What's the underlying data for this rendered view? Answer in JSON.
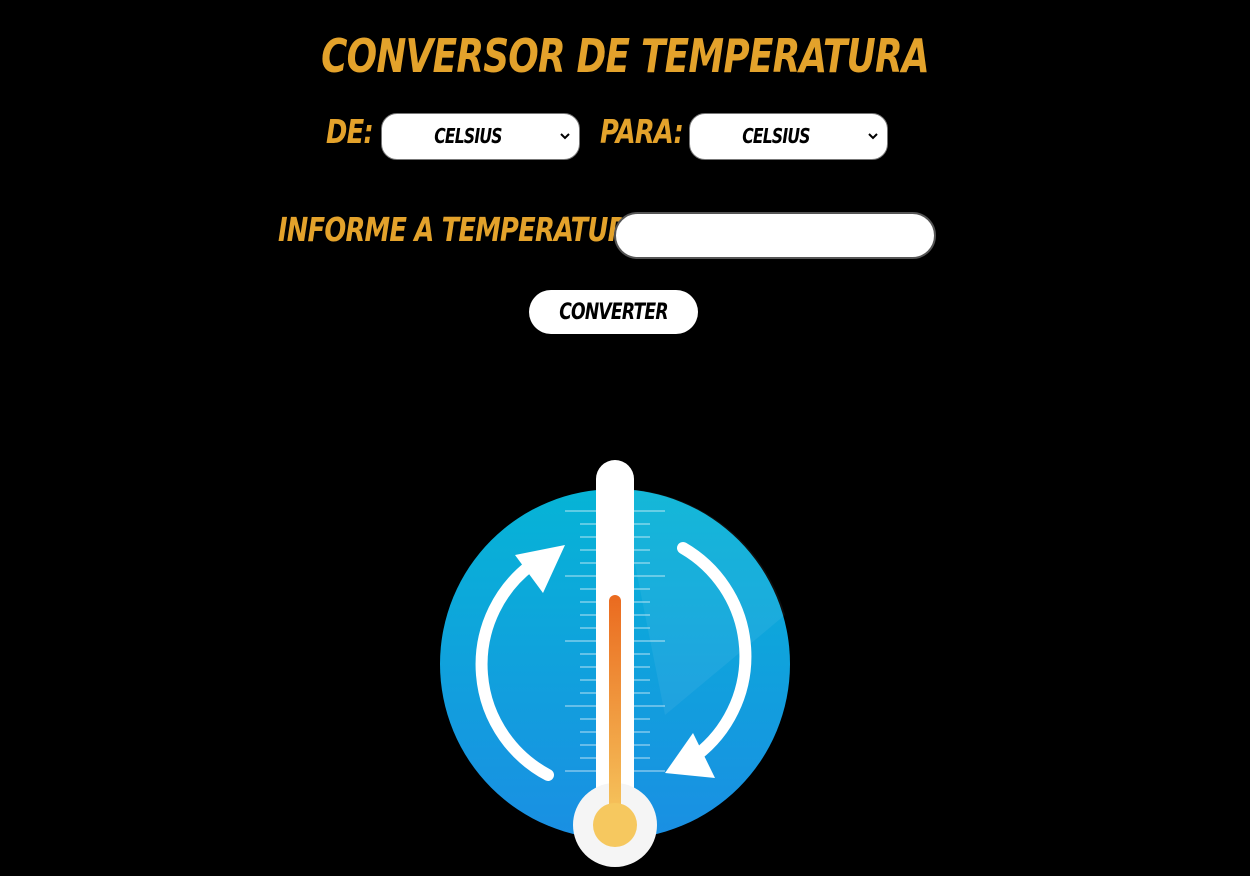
{
  "header": {
    "title": "CONVERSOR DE TEMPERATURA"
  },
  "form": {
    "from_label": "DE:",
    "from_value": "CELSIUS",
    "to_label": "PARA:",
    "to_value": "CELSIUS",
    "temperature_label": "INFORME A TEMPERATURA:",
    "temperature_value": "",
    "convert_label": "CONVERTER"
  },
  "illustration": {
    "icon": "thermometer-conversion-icon",
    "colors": {
      "accent": "#e3a22b",
      "circle_top": "#06b4d6",
      "circle_bottom": "#1a8fe3",
      "mercury": "#f08a24",
      "bulb": "#f6c85f"
    }
  }
}
